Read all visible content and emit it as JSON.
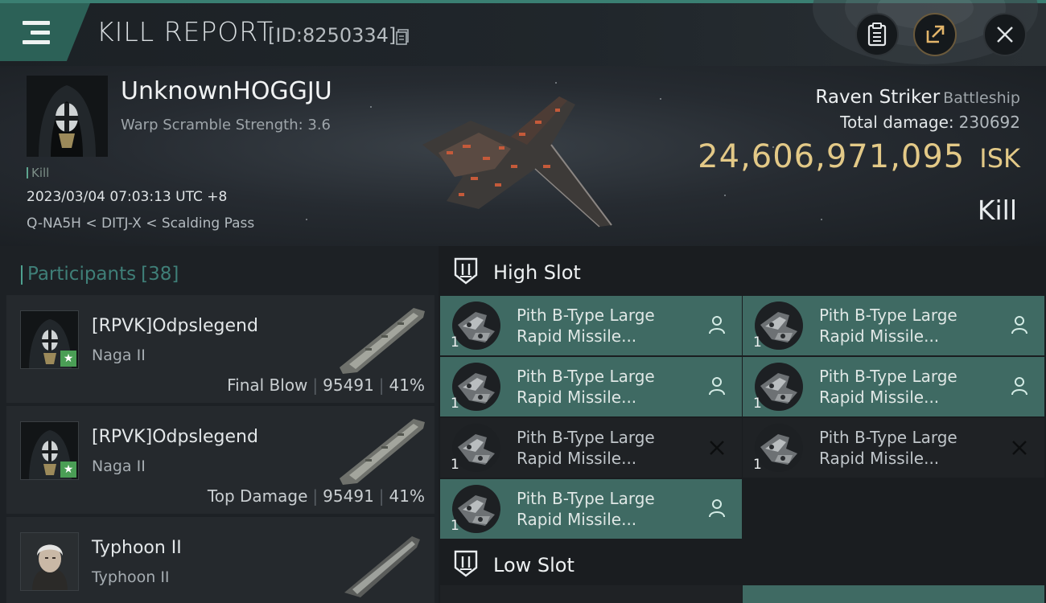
{
  "header": {
    "title": "KILL REPORT",
    "report_id": "[ID:8250334]"
  },
  "victim": {
    "name": "UnknownHOGGJU",
    "warp_scramble": "Warp Scramble Strength: 3.6",
    "kill_tag": "Kill",
    "datetime": "2023/03/04 07:03:13 UTC +8",
    "location": "Q-NA5H < DITJ-X < Scalding Pass",
    "ship_name": "Raven Striker",
    "ship_class": "Battleship",
    "total_damage_label": "Total damage:",
    "total_damage_value": "230692",
    "isk_value": "24,606,971,095",
    "isk_unit": "ISK",
    "result": "Kill"
  },
  "participants": {
    "label": "Participants",
    "count": "[38]",
    "rows": [
      {
        "name": "[RPVK]Odpslegend",
        "ship": "Naga II",
        "role": "Final Blow",
        "damage": "95491",
        "percent": "41%"
      },
      {
        "name": "[RPVK]Odpslegend",
        "ship": "Naga II",
        "role": "Top Damage",
        "damage": "95491",
        "percent": "41%"
      },
      {
        "name": "Typhoon II",
        "ship": "Typhoon II"
      }
    ]
  },
  "slots": {
    "high_slot_label": "High Slot",
    "low_slot_label": "Low Slot",
    "high_modules": [
      {
        "line1": "Pith B-Type Large",
        "line2": "Rapid Missile...",
        "qty": "1",
        "status": "person-icon",
        "state": "on"
      },
      {
        "line1": "Pith B-Type Large",
        "line2": "Rapid Missile...",
        "qty": "1",
        "status": "person-icon",
        "state": "on"
      },
      {
        "line1": "Pith B-Type Large",
        "line2": "Rapid Missile...",
        "qty": "1",
        "status": "person-icon",
        "state": "on"
      },
      {
        "line1": "Pith B-Type Large",
        "line2": "Rapid Missile...",
        "qty": "1",
        "status": "person-icon",
        "state": "on"
      },
      {
        "line1": "Pith B-Type Large",
        "line2": "Rapid Missile...",
        "qty": "1",
        "status": "close-icon",
        "state": "off"
      },
      {
        "line1": "Pith B-Type Large",
        "line2": "Rapid Missile...",
        "qty": "1",
        "status": "close-icon",
        "state": "off"
      },
      {
        "line1": "Pith B-Type Large",
        "line2": "Rapid Missile...",
        "qty": "1",
        "status": "person-icon",
        "state": "on"
      }
    ]
  },
  "colors": {
    "accent": "#3f6a63",
    "isk_gold": "#e3c987",
    "participants_teal": "#3f7f78"
  }
}
